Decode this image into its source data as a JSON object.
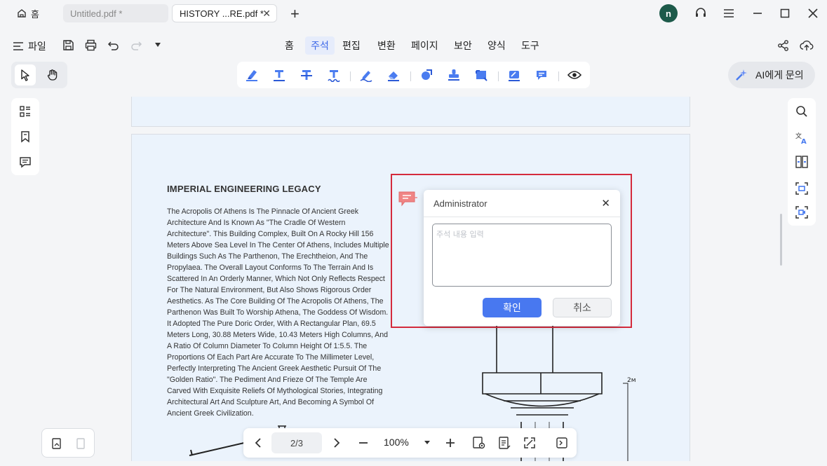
{
  "titlebar": {
    "home_tab": "홈",
    "tabs": [
      {
        "label": "Untitled.pdf *"
      },
      {
        "label": "HISTORY ...RE.pdf *"
      }
    ],
    "add_tab": "+",
    "avatar_initial": "n"
  },
  "menubar": {
    "file_label": "파일",
    "items": [
      "홈",
      "주석",
      "편집",
      "변환",
      "페이지",
      "보안",
      "양식",
      "도구"
    ],
    "active_item": "주석"
  },
  "ai_button": {
    "label": "AI에게 문의"
  },
  "document": {
    "heading": "IMPERIAL ENGINEERING LEGACY",
    "body_lines": [
      "The Acropolis Of Athens Is The Pinnacle Of Ancient Greek",
      "Architecture And Is Known As \"The Cradle Of Western",
      "Architecture\". This Building Complex, Built On A Rocky Hill 156",
      "Meters Above Sea Level In The Center Of Athens, Includes Multiple",
      "Buildings Such As The Parthenon, The Erechtheion, And The",
      "Propylaea. The Overall Layout Conforms To The Terrain And Is",
      "Scattered In An Orderly Manner, Which Not Only Reflects Respect",
      "For The Natural Environment, But Also Shows Rigorous Order",
      "Aesthetics. As The Core Building Of The Acropolis Of Athens, The",
      "Parthenon Was Built To Worship Athena, The Goddess Of Wisdom.",
      "It Adopted The Pure Doric Order, With A Rectangular Plan, 69.5",
      "Meters Long, 30.88 Meters Wide, 10.43 Meters High Columns, And",
      "A Ratio Of Column Diameter To Column Height Of 1:5.5. The",
      "Proportions Of Each Part Are Accurate To The Millimeter Level,",
      "Perfectly Interpreting The Ancient Greek Aesthetic Pursuit Of The",
      "\"Golden Ratio\". The Pediment And Frieze Of The Temple Are",
      "Carved With Exquisite Reliefs Of Mythological Stories, Integrating",
      "Architectural Art And Sculpture Art, And Becoming A Symbol Of",
      "Ancient Greek Civilization."
    ],
    "drawing_label": "2м"
  },
  "comment": {
    "author": "Administrator",
    "placeholder": "주석 내용 입력",
    "confirm_label": "확인",
    "cancel_label": "취소"
  },
  "bottombar": {
    "page_indicator": "2/3",
    "zoom": "100%"
  },
  "colors": {
    "accent": "#4878f0",
    "selection": "#d42a3c",
    "page_bg": "#ebf3fc"
  }
}
